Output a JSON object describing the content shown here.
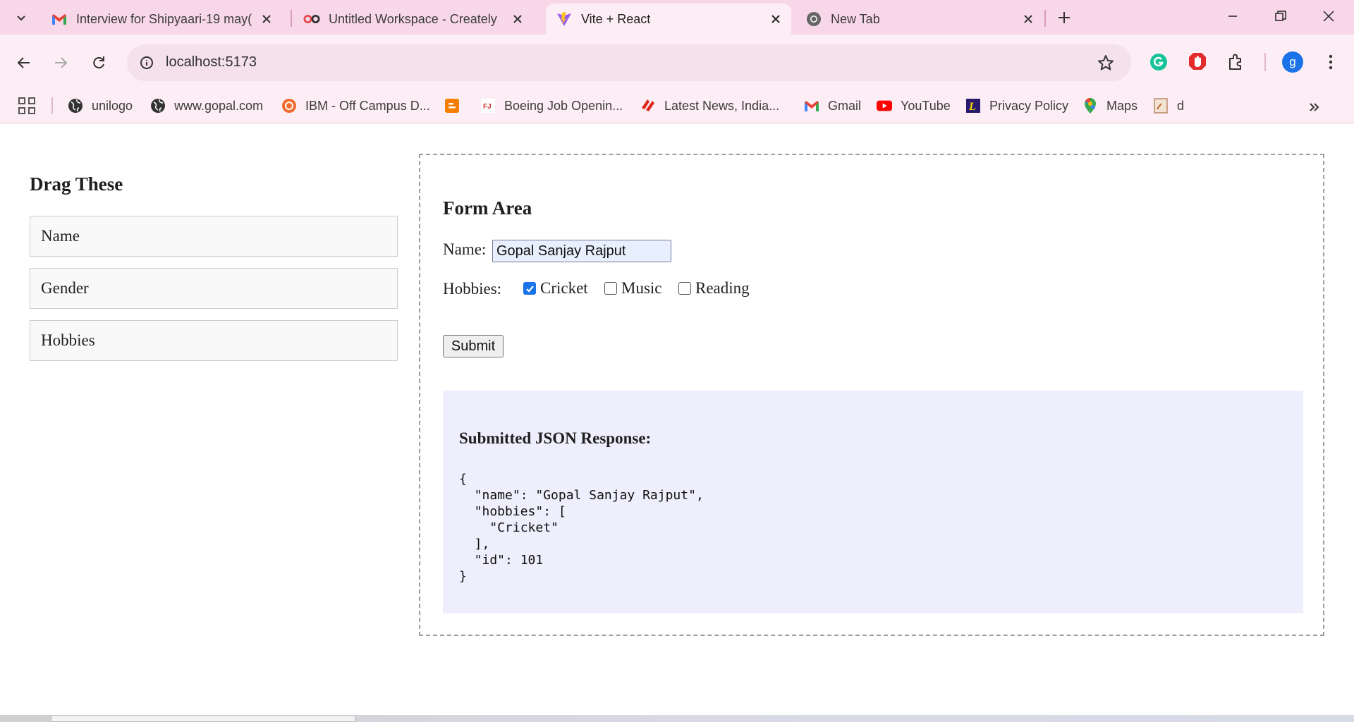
{
  "browser": {
    "tabs": [
      {
        "title": "Interview for Shipyaari-19 may(",
        "icon": "gmail-icon"
      },
      {
        "title": "Untitled Workspace - Creately",
        "icon": "creately-icon"
      },
      {
        "title": "Vite + React",
        "icon": "vite-icon",
        "active": true
      },
      {
        "title": "New Tab",
        "icon": "chrome-icon"
      }
    ],
    "url": "localhost:5173",
    "profile_initial": "g",
    "bookmarks": [
      {
        "label": "unilogo",
        "icon": "globe-icon"
      },
      {
        "label": "www.gopal.com",
        "icon": "globe-icon"
      },
      {
        "label": "IBM - Off Campus D...",
        "icon": "ibm-icon"
      },
      {
        "label": "",
        "icon": "blogger-icon"
      },
      {
        "label": "Boeing Job Openin...",
        "icon": "fj-icon"
      },
      {
        "label": "Latest News, India...",
        "icon": "news-icon"
      },
      {
        "label": "Gmail",
        "icon": "gmail-icon"
      },
      {
        "label": "YouTube",
        "icon": "youtube-icon"
      },
      {
        "label": "Privacy Policy",
        "icon": "privacy-icon"
      },
      {
        "label": "Maps",
        "icon": "maps-icon"
      },
      {
        "label": "d",
        "icon": "doc-icon"
      }
    ]
  },
  "page": {
    "drag_title": "Drag These",
    "drag_items": [
      "Name",
      "Gender",
      "Hobbies"
    ],
    "form": {
      "title": "Form Area",
      "name_label": "Name:",
      "name_value": "Gopal Sanjay Rajput",
      "hobbies_label": "Hobbies:",
      "hobbies": [
        {
          "label": "Cricket",
          "checked": true
        },
        {
          "label": "Music",
          "checked": false
        },
        {
          "label": "Reading",
          "checked": false
        }
      ],
      "submit_label": "Submit"
    },
    "response": {
      "title": "Submitted JSON Response:",
      "json_text": "{\n  \"name\": \"Gopal Sanjay Rajput\",\n  \"hobbies\": [\n    \"Cricket\"\n  ],\n  \"id\": 101\n}"
    }
  },
  "colors": {
    "tabstrip": "#f8d7e8",
    "toolbar": "#fdeef5",
    "json_box": "#eeeefd",
    "accent": "#1a73e8"
  }
}
